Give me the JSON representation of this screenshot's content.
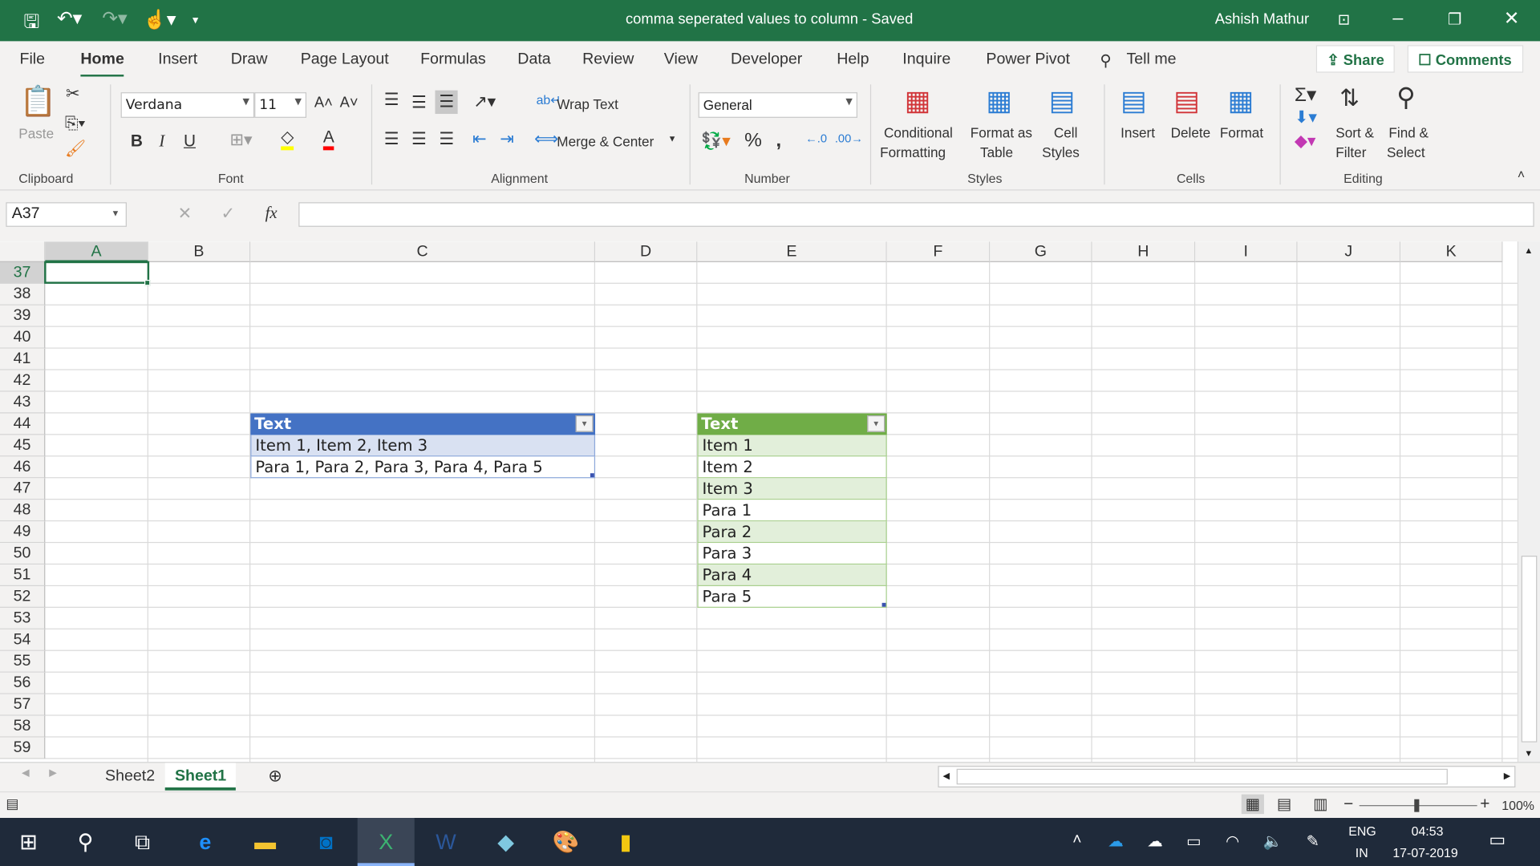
{
  "titlebar": {
    "title": "comma seperated values to column  -  Saved",
    "user": "Ashish Mathur"
  },
  "menu": {
    "tabs": [
      "File",
      "Home",
      "Insert",
      "Draw",
      "Page Layout",
      "Formulas",
      "Data",
      "Review",
      "View",
      "Developer",
      "Help",
      "Inquire",
      "Power Pivot"
    ],
    "active": "Home",
    "tell_me": "Tell me",
    "share": "Share",
    "comments": "Comments"
  },
  "ribbon": {
    "clipboard": {
      "label": "Clipboard",
      "paste": "Paste"
    },
    "font": {
      "label": "Font",
      "name": "Verdana",
      "size": "11",
      "bold": "B",
      "italic": "I",
      "underline": "U"
    },
    "alignment": {
      "label": "Alignment",
      "wrap": "Wrap Text",
      "merge": "Merge & Center"
    },
    "number": {
      "label": "Number",
      "format": "General"
    },
    "styles": {
      "label": "Styles",
      "conditional": [
        "Conditional",
        "Formatting"
      ],
      "format_table": [
        "Format as",
        "Table"
      ],
      "cell_styles": [
        "Cell",
        "Styles"
      ]
    },
    "cells": {
      "label": "Cells",
      "insert": "Insert",
      "delete": "Delete",
      "format": "Format"
    },
    "editing": {
      "label": "Editing",
      "sort": [
        "Sort &",
        "Filter"
      ],
      "find": [
        "Find &",
        "Select"
      ]
    }
  },
  "formula_bar": {
    "name_box": "A37",
    "fx": "fx",
    "value": ""
  },
  "grid": {
    "columns": [
      "A",
      "B",
      "C",
      "D",
      "E",
      "F",
      "G",
      "H",
      "I",
      "J",
      "K"
    ],
    "rows": [
      "37",
      "38",
      "39",
      "40",
      "41",
      "42",
      "43",
      "44",
      "45",
      "46",
      "47",
      "48",
      "49",
      "50",
      "51",
      "52",
      "53",
      "54",
      "55",
      "56",
      "57",
      "58",
      "59"
    ],
    "selected_cell": "A37",
    "table1": {
      "header": "Text",
      "rows": [
        "Item 1, Item 2, Item 3",
        "Para 1, Para 2, Para 3, Para 4, Para 5"
      ],
      "header_color": "#4472c4",
      "band_color": "#d9e1f2"
    },
    "table2": {
      "header": "Text",
      "rows": [
        "Item 1",
        "Item 2",
        "Item 3",
        "Para 1",
        "Para 2",
        "Para 3",
        "Para 4",
        "Para 5"
      ],
      "header_color": "#70ad47",
      "band_color": "#e2efda"
    }
  },
  "sheets": {
    "tabs": [
      "Sheet2",
      "Sheet1"
    ],
    "active": "Sheet1"
  },
  "status": {
    "zoom": "100%"
  },
  "taskbar": {
    "lang": "ENG",
    "region": "IN",
    "time": "04:53",
    "date": "17-07-2019"
  }
}
